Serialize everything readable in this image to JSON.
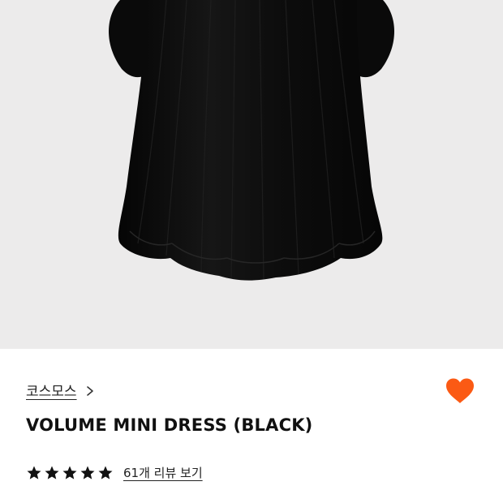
{
  "product": {
    "image_alt_icon": "dress-product-image",
    "brand": "코스모스",
    "brand_chevron_icon": "chevron-right-icon",
    "title": "VOLUME MINI DRESS (BLACK)",
    "wishlist_icon": "heart-icon",
    "wishlist_color": "#fb5a14",
    "rating": {
      "stars": 5,
      "star_color": "#111111",
      "review_link": "61개 리뷰 보기"
    }
  },
  "colors": {
    "hero_background": "#ecebeb",
    "dress": "#0e0e0e"
  }
}
